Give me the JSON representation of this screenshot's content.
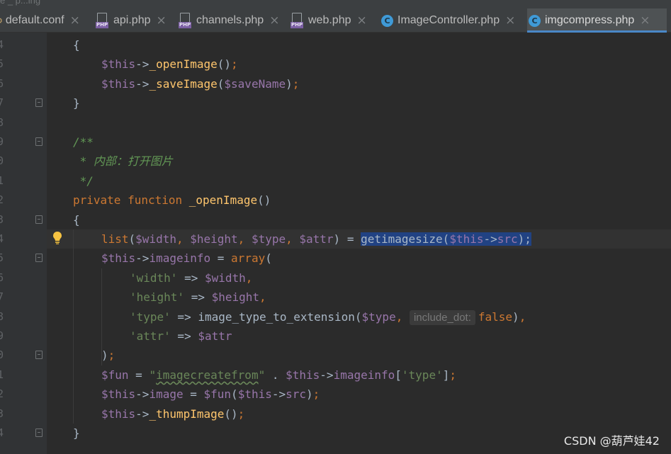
{
  "window": {
    "top_fragment": "e _ p...ing"
  },
  "tabs": [
    {
      "label": "default.conf",
      "icon": "config-file-icon",
      "active": false
    },
    {
      "label": "api.php",
      "icon": "php-file-icon",
      "active": false
    },
    {
      "label": "channels.php",
      "icon": "php-file-icon",
      "active": false
    },
    {
      "label": "web.php",
      "icon": "php-file-icon",
      "active": false
    },
    {
      "label": "ImageController.php",
      "icon": "php-class-icon",
      "active": false
    },
    {
      "label": "imgcompress.php",
      "icon": "php-class-icon",
      "active": true
    }
  ],
  "tab_close_glyph": "×",
  "php_badge": "PHP",
  "class_badge": "C",
  "editor": {
    "lines": [
      {
        "ln": "4",
        "fold": false,
        "current": false,
        "indent": 0,
        "tokens": [
          {
            "t": "{",
            "c": ""
          }
        ]
      },
      {
        "ln": "5",
        "fold": false,
        "current": false,
        "indent": 1,
        "tokens": [
          {
            "t": "$this",
            "c": "var"
          },
          {
            "t": "->",
            "c": ""
          },
          {
            "t": "_openImage",
            "c": "fn"
          },
          {
            "t": "()",
            "c": ""
          },
          {
            "t": ";",
            "c": "kw"
          }
        ]
      },
      {
        "ln": "6",
        "fold": false,
        "current": false,
        "indent": 1,
        "tokens": [
          {
            "t": "$this",
            "c": "var"
          },
          {
            "t": "->",
            "c": ""
          },
          {
            "t": "_saveImage",
            "c": "fn"
          },
          {
            "t": "(",
            "c": ""
          },
          {
            "t": "$saveName",
            "c": "var"
          },
          {
            "t": ")",
            "c": ""
          },
          {
            "t": ";",
            "c": "kw"
          }
        ]
      },
      {
        "ln": "7",
        "fold": true,
        "current": false,
        "indent": 0,
        "tokens": [
          {
            "t": "}",
            "c": ""
          }
        ]
      },
      {
        "ln": "8",
        "fold": false,
        "current": false,
        "indent": 0,
        "tokens": []
      },
      {
        "ln": "9",
        "fold": true,
        "current": false,
        "indent": 0,
        "tokens": [
          {
            "t": "/**",
            "c": "cm"
          }
        ]
      },
      {
        "ln": "0",
        "fold": false,
        "current": false,
        "indent": 0,
        "tokens": [
          {
            "t": " * 内部：打开图片",
            "c": "cm"
          }
        ]
      },
      {
        "ln": "1",
        "fold": false,
        "current": false,
        "indent": 0,
        "tokens": [
          {
            "t": " */",
            "c": "cm"
          }
        ]
      },
      {
        "ln": "2",
        "fold": false,
        "current": false,
        "indent": 0,
        "tokens": [
          {
            "t": "private ",
            "c": "kw"
          },
          {
            "t": "function ",
            "c": "kw"
          },
          {
            "t": "_openImage",
            "c": "fn"
          },
          {
            "t": "()",
            "c": ""
          }
        ]
      },
      {
        "ln": "3",
        "fold": true,
        "current": false,
        "indent": 0,
        "tokens": [
          {
            "t": "{",
            "c": ""
          }
        ]
      },
      {
        "ln": "4",
        "fold": false,
        "current": true,
        "indent": 1,
        "tokens": [
          {
            "t": "list",
            "c": "kw"
          },
          {
            "t": "(",
            "c": ""
          },
          {
            "t": "$width",
            "c": "var"
          },
          {
            "t": ", ",
            "c": "kw"
          },
          {
            "t": "$height",
            "c": "var"
          },
          {
            "t": ", ",
            "c": "kw"
          },
          {
            "t": "$type",
            "c": "var"
          },
          {
            "t": ", ",
            "c": "kw"
          },
          {
            "t": "$attr",
            "c": "var"
          },
          {
            "t": ") = ",
            "c": ""
          },
          {
            "t": "getimagesize(",
            "c": "hl"
          },
          {
            "t": "$this",
            "c": "hl var"
          },
          {
            "t": "->",
            "c": "hl"
          },
          {
            "t": "src",
            "c": "hl var"
          },
          {
            "t": ");",
            "c": "hl"
          }
        ]
      },
      {
        "ln": "5",
        "fold": true,
        "current": false,
        "indent": 1,
        "tokens": [
          {
            "t": "$this",
            "c": "var"
          },
          {
            "t": "->",
            "c": ""
          },
          {
            "t": "imageinfo",
            "c": "var"
          },
          {
            "t": " = ",
            "c": ""
          },
          {
            "t": "array",
            "c": "kw"
          },
          {
            "t": "(",
            "c": ""
          }
        ]
      },
      {
        "ln": "6",
        "fold": false,
        "current": false,
        "indent": 2,
        "tokens": [
          {
            "t": "'width'",
            "c": "str"
          },
          {
            "t": " => ",
            "c": ""
          },
          {
            "t": "$width",
            "c": "var"
          },
          {
            "t": ",",
            "c": "kw"
          }
        ]
      },
      {
        "ln": "7",
        "fold": false,
        "current": false,
        "indent": 2,
        "tokens": [
          {
            "t": "'height'",
            "c": "str"
          },
          {
            "t": " => ",
            "c": ""
          },
          {
            "t": "$height",
            "c": "var"
          },
          {
            "t": ",",
            "c": "kw"
          }
        ]
      },
      {
        "ln": "8",
        "fold": false,
        "current": false,
        "indent": 2,
        "tokens": [
          {
            "t": "'type'",
            "c": "str"
          },
          {
            "t": " => ",
            "c": ""
          },
          {
            "t": "image_type_to_extension",
            "c": ""
          },
          {
            "t": "(",
            "c": ""
          },
          {
            "t": "$type",
            "c": "var"
          },
          {
            "t": ", ",
            "c": "kw"
          },
          {
            "t": "include_dot:",
            "c": "hint"
          },
          {
            "t": "false",
            "c": "kw"
          },
          {
            "t": ")",
            "c": ""
          },
          {
            "t": ",",
            "c": "kw"
          }
        ]
      },
      {
        "ln": "9",
        "fold": false,
        "current": false,
        "indent": 2,
        "tokens": [
          {
            "t": "'attr'",
            "c": "str"
          },
          {
            "t": " => ",
            "c": ""
          },
          {
            "t": "$attr",
            "c": "var"
          }
        ]
      },
      {
        "ln": "0",
        "fold": true,
        "current": false,
        "indent": 1,
        "tokens": [
          {
            "t": ")",
            "c": ""
          },
          {
            "t": ";",
            "c": "kw"
          }
        ]
      },
      {
        "ln": "1",
        "fold": false,
        "current": false,
        "indent": 1,
        "tokens": [
          {
            "t": "$fun",
            "c": "var"
          },
          {
            "t": " = ",
            "c": ""
          },
          {
            "t": "\"",
            "c": "str"
          },
          {
            "t": "imagecreatefrom",
            "c": "str sq"
          },
          {
            "t": "\"",
            "c": "str"
          },
          {
            "t": " . ",
            "c": ""
          },
          {
            "t": "$this",
            "c": "var"
          },
          {
            "t": "->",
            "c": ""
          },
          {
            "t": "imageinfo",
            "c": "var"
          },
          {
            "t": "[",
            "c": ""
          },
          {
            "t": "'type'",
            "c": "str"
          },
          {
            "t": "]",
            "c": ""
          },
          {
            "t": ";",
            "c": "kw"
          }
        ]
      },
      {
        "ln": "2",
        "fold": false,
        "current": false,
        "indent": 1,
        "tokens": [
          {
            "t": "$this",
            "c": "var"
          },
          {
            "t": "->",
            "c": ""
          },
          {
            "t": "image",
            "c": "var"
          },
          {
            "t": " = ",
            "c": ""
          },
          {
            "t": "$fun",
            "c": "var"
          },
          {
            "t": "(",
            "c": ""
          },
          {
            "t": "$this",
            "c": "var"
          },
          {
            "t": "->",
            "c": ""
          },
          {
            "t": "src",
            "c": "var"
          },
          {
            "t": ")",
            "c": ""
          },
          {
            "t": ";",
            "c": "kw"
          }
        ]
      },
      {
        "ln": "3",
        "fold": false,
        "current": false,
        "indent": 1,
        "tokens": [
          {
            "t": "$this",
            "c": "var"
          },
          {
            "t": "->",
            "c": ""
          },
          {
            "t": "_thumpImage",
            "c": "fn"
          },
          {
            "t": "()",
            "c": ""
          },
          {
            "t": ";",
            "c": "kw"
          }
        ]
      },
      {
        "ln": "4",
        "fold": true,
        "current": false,
        "indent": 0,
        "tokens": [
          {
            "t": "}",
            "c": ""
          }
        ]
      }
    ]
  },
  "colors": {
    "background": "#2b2b2b",
    "keyword": "#cc7832",
    "variable": "#9876aa",
    "function": "#ffc66d",
    "string": "#6a8759",
    "comment": "#629755",
    "selection": "#214283",
    "active_tab_underline": "#4a88c7"
  },
  "watermark": "CSDN @葫芦娃42"
}
